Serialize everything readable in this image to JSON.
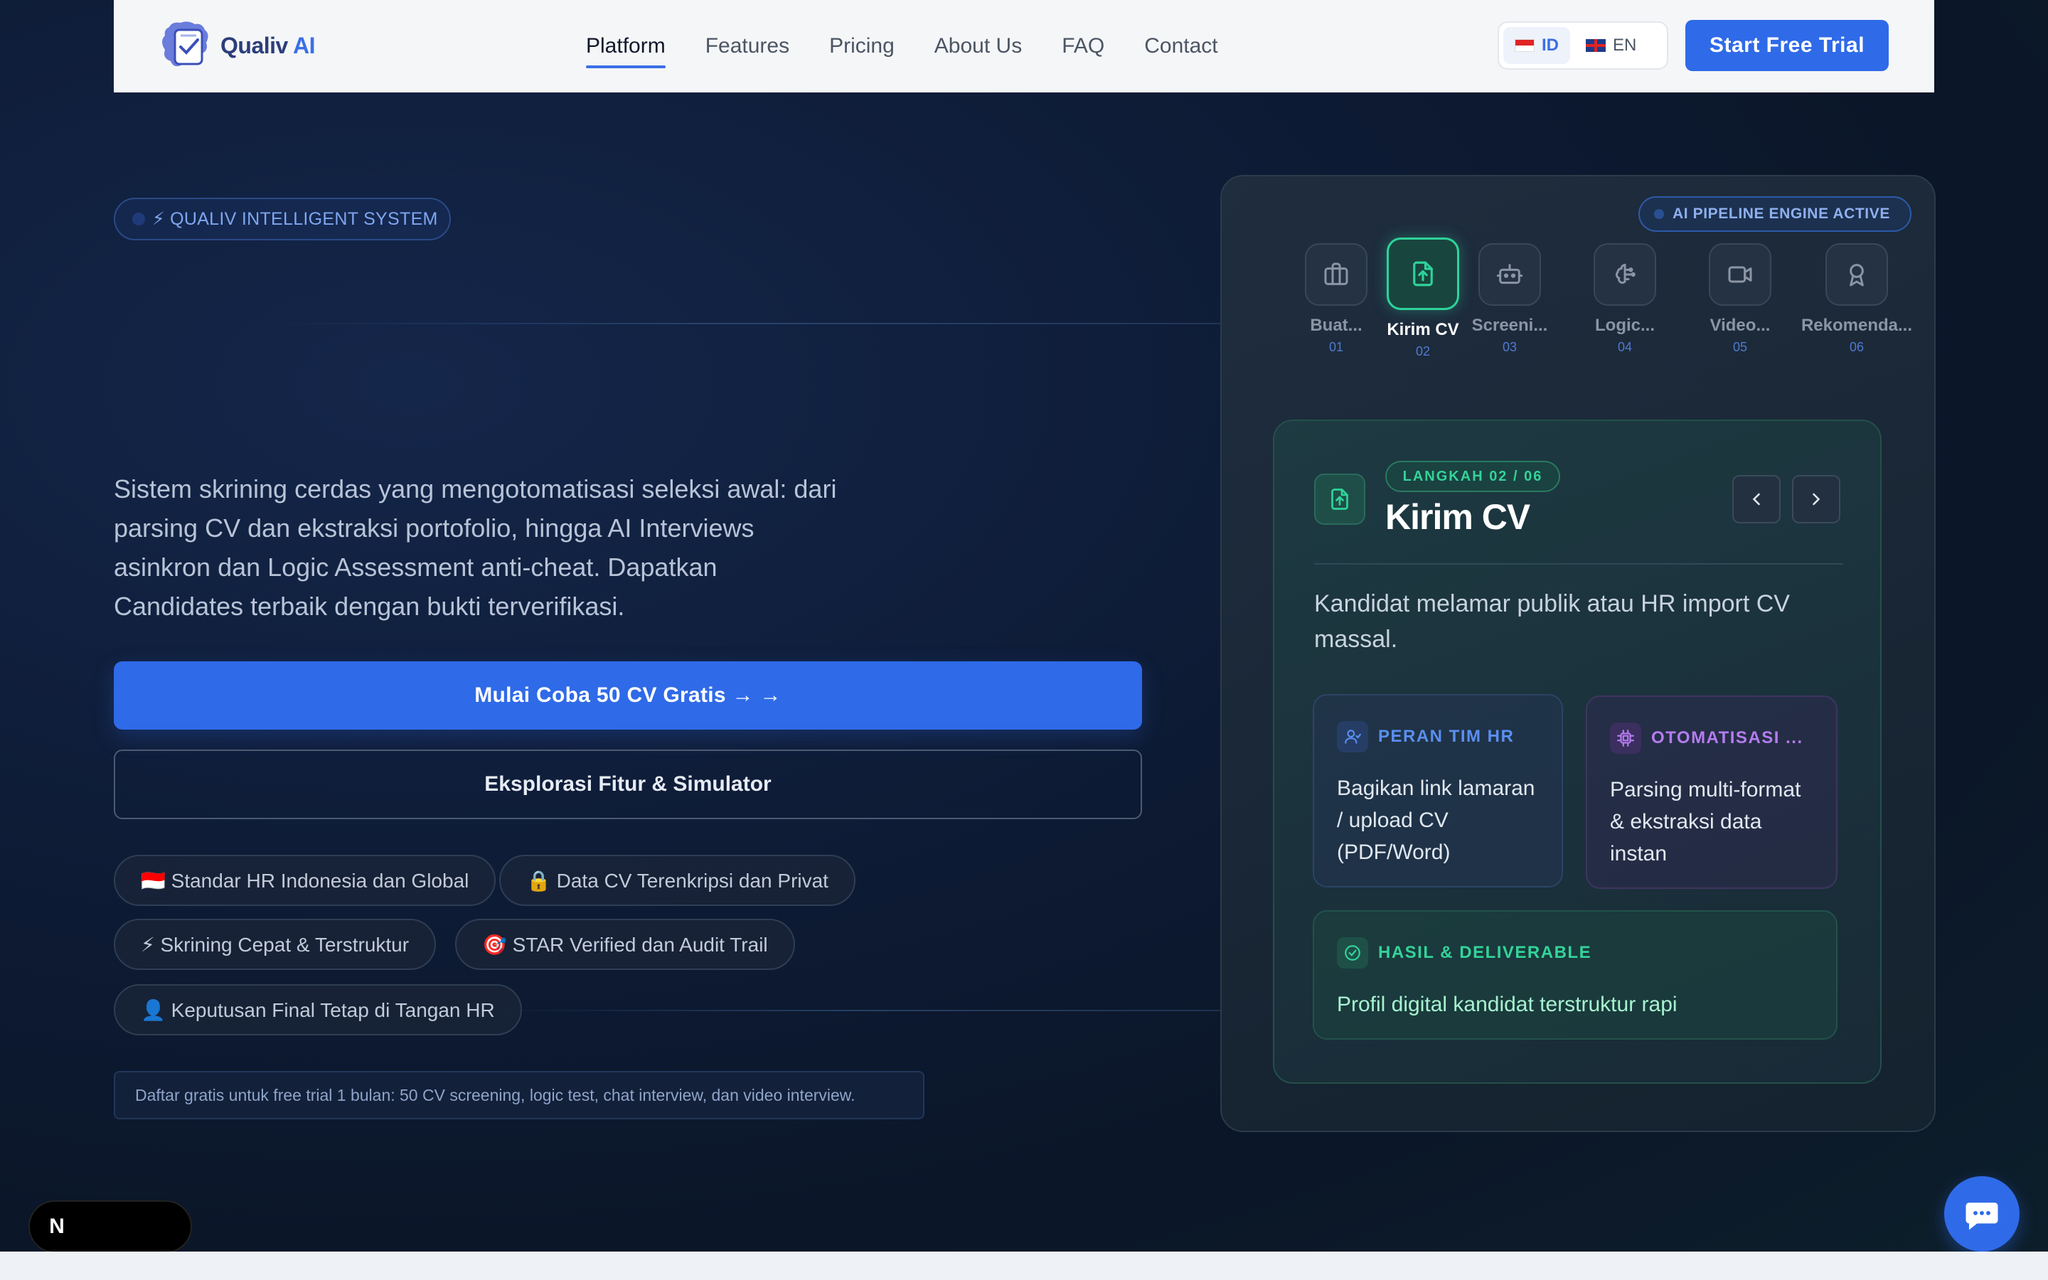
{
  "brand": {
    "name": "Qualiv",
    "name_suffix": "AI",
    "colors": {
      "primary": "#2f6ae8",
      "accent_green": "#34d399",
      "accent_purple": "#b57cf0"
    }
  },
  "nav": {
    "links": [
      "Platform",
      "Features",
      "Pricing",
      "About Us",
      "FAQ",
      "Contact"
    ],
    "active": "Platform",
    "languages": [
      {
        "code": "ID",
        "icon": "flag-indonesia",
        "active": true
      },
      {
        "code": "EN",
        "icon": "flag-uk",
        "active": false
      }
    ],
    "cta": "Start Free Trial"
  },
  "hero": {
    "badge": "⚡ QUALIV INTELLIGENT SYSTEM",
    "description": "Sistem skrining cerdas yang mengotomatisasi seleksi awal: dari parsing CV dan ekstraksi portofolio, hingga AI Interviews asinkron dan Logic Assessment anti-cheat. Dapatkan Candidates terbaik dengan bukti terverifikasi.",
    "primary_cta": "Mulai Coba 50 CV Gratis → →",
    "secondary_cta": "Eksplorasi Fitur & Simulator",
    "chips": [
      "🇮🇩 Standar HR Indonesia dan Global",
      "🔒 Data CV Terenkripsi dan Privat",
      "⚡ Skrining Cepat & Terstruktur",
      "🎯 STAR Verified dan Audit Trail",
      "👤 Keputusan Final Tetap di Tangan HR"
    ],
    "notice": "Daftar gratis untuk free trial 1 bulan: 50 CV screening, logic test, chat interview, dan video interview."
  },
  "pipeline": {
    "engine_badge": "AI PIPELINE ENGINE ACTIVE",
    "steps": [
      {
        "label": "Buat...",
        "num": "01",
        "icon": "briefcase-icon"
      },
      {
        "label": "Kirim CV",
        "num": "02",
        "icon": "file-upload-icon",
        "active": true
      },
      {
        "label": "Screeni...",
        "num": "03",
        "icon": "robot-icon"
      },
      {
        "label": "Logic...",
        "num": "04",
        "icon": "brain-icon"
      },
      {
        "label": "Video...",
        "num": "05",
        "icon": "video-icon"
      },
      {
        "label": "Rekomenda...",
        "num": "06",
        "icon": "award-icon"
      }
    ],
    "detail": {
      "step_badge": "LANGKAH 02 / 06",
      "title": "Kirim CV",
      "description": "Kandidat melamar publik atau HR import CV massal.",
      "hr_role": {
        "title": "PERAN TIM HR",
        "body": "Bagikan link lamaran / upload CV (PDF/Word)"
      },
      "ai_role": {
        "title": "OTOMATISASI ...",
        "body": "Parsing multi-format & ekstraksi data instan"
      },
      "result": {
        "title": "HASIL & DELIVERABLE",
        "body": "Profil digital kandidat terstruktur rapi"
      }
    }
  },
  "overlays": {
    "dev_badge": "N"
  }
}
